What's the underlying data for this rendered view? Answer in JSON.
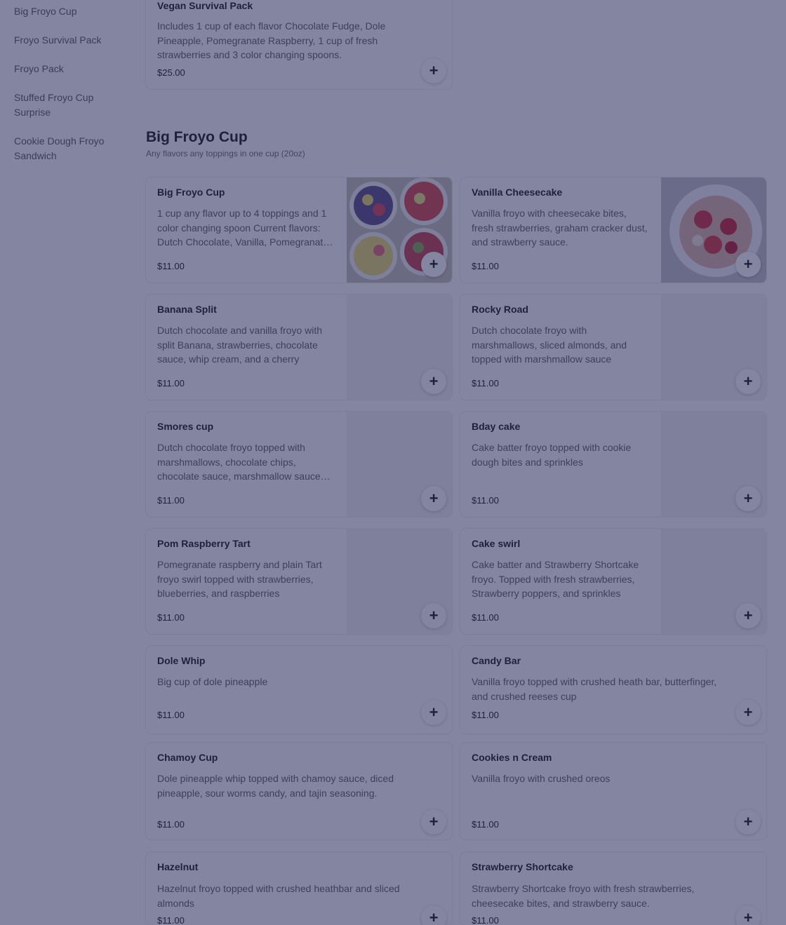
{
  "sidebar": {
    "items": [
      {
        "label": "Big Froyo Cup"
      },
      {
        "label": "Froyo Survival Pack"
      },
      {
        "label": "Froyo Pack"
      },
      {
        "label": "Stuffed Froyo Cup Surprise"
      },
      {
        "label": "Cookie Dough Froyo Sandwich"
      }
    ]
  },
  "previous_item": {
    "name": "Vegan Survival Pack",
    "description": "Includes 1 cup of each flavor Chocolate Fudge, Dole Pineapple, Pomegranate Raspberry, 1 cup of fresh strawberries and 3 color changing spoons.",
    "price": "$25.00"
  },
  "section": {
    "title": "Big Froyo Cup",
    "subtitle": "Any flavors any toppings in one cup (20oz)",
    "items": [
      {
        "name": "Big Froyo Cup",
        "description": "1 cup any flavor up to 4 toppings and 1 color changing spoon Current flavors: Dutch Chocolate, Vanilla, Pomegranate Raspberry, Cake Batter",
        "price": "$11.00"
      },
      {
        "name": "Vanilla Cheesecake",
        "description": "Vanilla froyo with cheesecake bites, fresh strawberries, graham cracker dust, and strawberry sauce.",
        "price": "$11.00"
      },
      {
        "name": "Banana Split",
        "description": "Dutch chocolate and vanilla froyo with split Banana, strawberries, chocolate sauce, whip cream, and a cherry",
        "price": "$11.00"
      },
      {
        "name": "Rocky Road",
        "description": "Dutch chocolate froyo with marshmallows, sliced almonds, and topped with marshmallow sauce",
        "price": "$11.00"
      },
      {
        "name": "Smores cup",
        "description": "Dutch chocolate froyo topped with marshmallows, chocolate chips, chocolate sauce, marshmallow sauce and graham cracker dust",
        "price": "$11.00"
      },
      {
        "name": "Bday cake",
        "description": "Cake batter froyo topped with cookie dough bites and sprinkles",
        "price": "$11.00"
      },
      {
        "name": "Pom Raspberry Tart",
        "description": "Pomegranate raspberry and plain Tart froyo swirl topped with strawberries, blueberries, and raspberries",
        "price": "$11.00"
      },
      {
        "name": "Cake swirl",
        "description": "Cake batter and Strawberry Shortcake froyo. Topped with fresh strawberries, Strawberry poppers, and sprinkles",
        "price": "$11.00"
      },
      {
        "name": "Dole Whip",
        "description": "Big cup of dole pineapple",
        "price": "$11.00"
      },
      {
        "name": "Candy Bar",
        "description": "Vanilla froyo topped with crushed heath bar, butterfinger, and crushed reeses cup",
        "price": "$11.00"
      },
      {
        "name": "Chamoy Cup",
        "description": "Dole pineapple whip topped with chamoy sauce, diced pineapple, sour worms candy, and tajin seasoning.",
        "price": "$11.00"
      },
      {
        "name": "Cookies n Cream",
        "description": "Vanilla froyo with crushed oreos",
        "price": "$11.00"
      },
      {
        "name": "Hazelnut",
        "description": "Hazelnut froyo topped with crushed heathbar and sliced almonds",
        "price": "$11.00"
      },
      {
        "name": "Strawberry Shortcake",
        "description": "Strawberry Shortcake froyo with fresh strawberries, cheesecake bites, and strawberry sauce.",
        "price": "$11.00"
      }
    ]
  },
  "icons": {
    "add": "plus-icon"
  },
  "colors": {
    "overlay": "#222658",
    "text": "#191919",
    "muted": "#606060"
  }
}
